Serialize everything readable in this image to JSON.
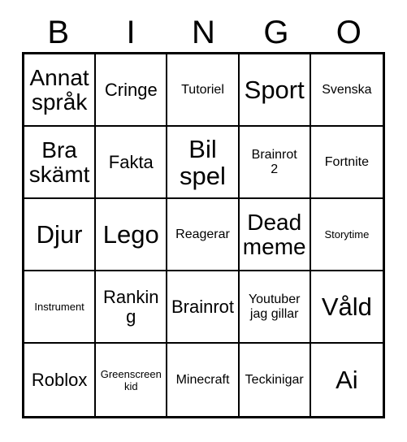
{
  "card": {
    "title_letters": [
      "B",
      "I",
      "N",
      "G",
      "O"
    ],
    "columns": 5,
    "rows": 5,
    "colors": {
      "background": "#ffffff",
      "text": "#000000",
      "grid_line": "#000000"
    },
    "cells": [
      {
        "text": "Annat\nspråk",
        "size": "lg"
      },
      {
        "text": "Cringe",
        "size": "md"
      },
      {
        "text": "Tutoriel",
        "size": "sm"
      },
      {
        "text": "Sport",
        "size": "xl"
      },
      {
        "text": "Svenska",
        "size": "sm"
      },
      {
        "text": "Bra\nskämt",
        "size": "lg"
      },
      {
        "text": "Fakta",
        "size": "md"
      },
      {
        "text": "Bil\nspel",
        "size": "xl"
      },
      {
        "text": "Brainrot\n2",
        "size": "sm"
      },
      {
        "text": "Fortnite",
        "size": "sm"
      },
      {
        "text": "Djur",
        "size": "xl"
      },
      {
        "text": "Lego",
        "size": "xl"
      },
      {
        "text": "Reagerar",
        "size": "sm"
      },
      {
        "text": "Dead\nmeme",
        "size": "lg"
      },
      {
        "text": "Storytime",
        "size": "xs"
      },
      {
        "text": "Instrument",
        "size": "xs"
      },
      {
        "text": "Ranking",
        "size": "md"
      },
      {
        "text": "Brainrot",
        "size": "md"
      },
      {
        "text": "Youtuber\njag gillar",
        "size": "sm"
      },
      {
        "text": "Våld",
        "size": "xl"
      },
      {
        "text": "Roblox",
        "size": "md"
      },
      {
        "text": "Greenscreen\nkid",
        "size": "xs"
      },
      {
        "text": "Minecraft",
        "size": "sm"
      },
      {
        "text": "Teckinigar",
        "size": "sm"
      },
      {
        "text": "Ai",
        "size": "xl"
      }
    ]
  }
}
